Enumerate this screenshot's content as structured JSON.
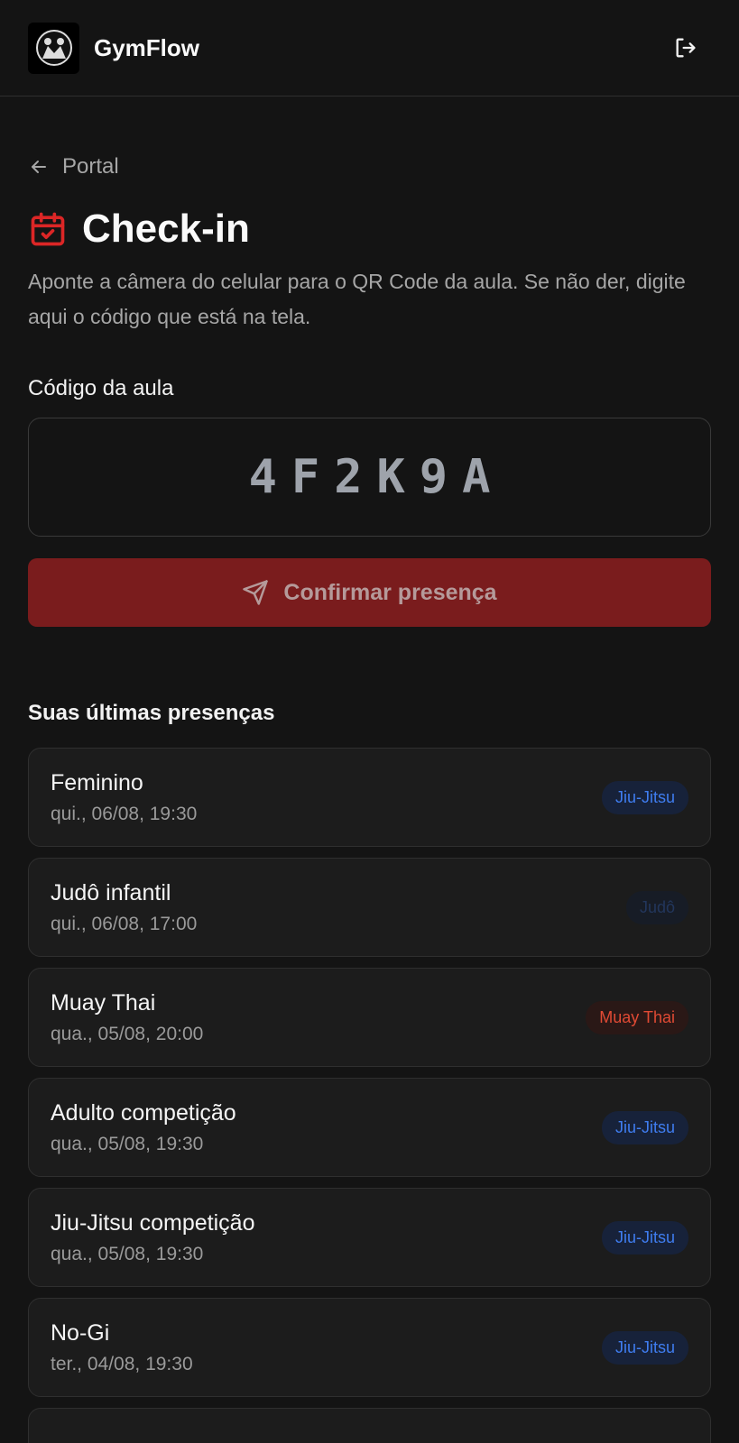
{
  "header": {
    "app_title": "GymFlow"
  },
  "nav": {
    "back_label": "Portal"
  },
  "page": {
    "title": "Check-in",
    "subtitle": "Aponte a câmera do celular para o QR Code da aula. Se não der, digite aqui o código que está na tela."
  },
  "code_field": {
    "label": "Código da aula",
    "value": "4F2K9A"
  },
  "confirm_button": {
    "label": "Confirmar presença"
  },
  "history": {
    "title": "Suas últimas presenças",
    "items": [
      {
        "name": "Feminino",
        "date": "qui., 06/08, 19:30",
        "badge": "Jiu-Jitsu"
      },
      {
        "name": "Judô infantil",
        "date": "qui., 06/08, 17:00",
        "badge": "Judô"
      },
      {
        "name": "Muay Thai",
        "date": "qua., 05/08, 20:00",
        "badge": "Muay Thai"
      },
      {
        "name": "Adulto competição",
        "date": "qua., 05/08, 19:30",
        "badge": "Jiu-Jitsu"
      },
      {
        "name": "Jiu-Jitsu competição",
        "date": "qua., 05/08, 19:30",
        "badge": "Jiu-Jitsu"
      },
      {
        "name": "No-Gi",
        "date": "ter., 04/08, 19:30",
        "badge": "Jiu-Jitsu"
      }
    ]
  },
  "colors": {
    "accent_red": "#dc2626",
    "button_red": "#7a1c1d",
    "badge_blue": "#3f7df0",
    "badge_red": "#e04a34"
  }
}
